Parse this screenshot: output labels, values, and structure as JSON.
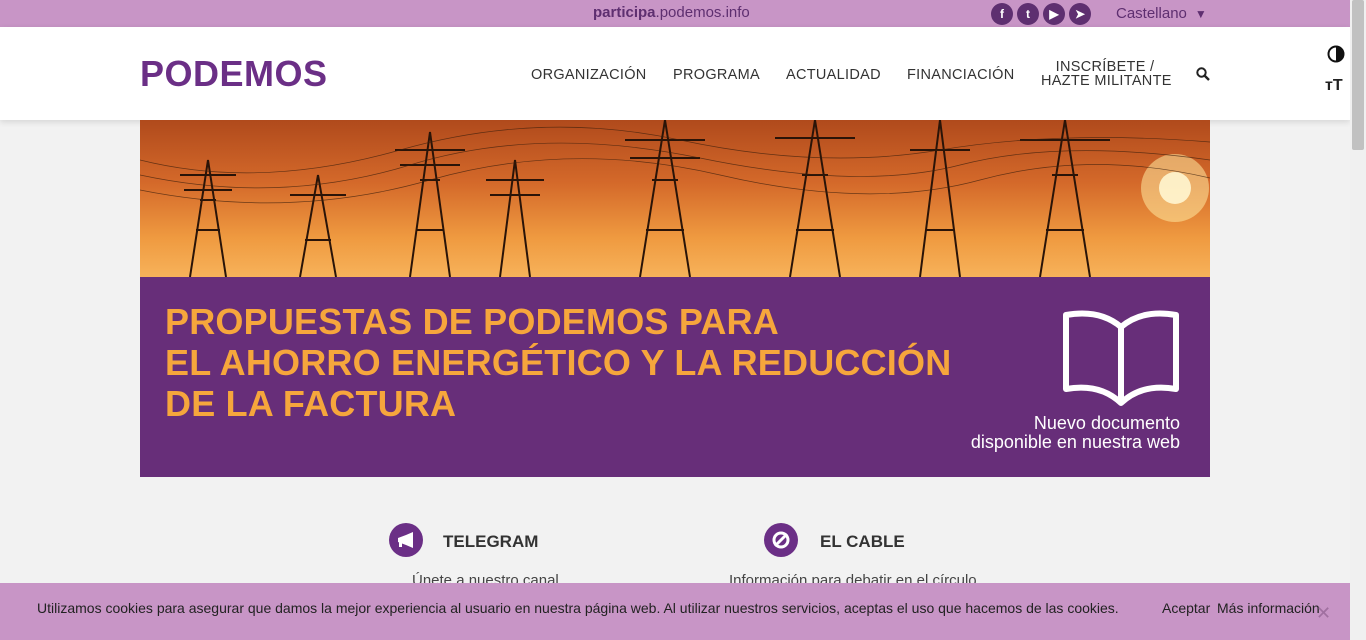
{
  "topbar": {
    "participa_bold": "participa",
    "participa_rest": ".podemos.info",
    "social": [
      {
        "name": "facebook-icon",
        "glyph": "f"
      },
      {
        "name": "twitter-icon",
        "glyph": "t"
      },
      {
        "name": "youtube-icon",
        "glyph": "▶"
      },
      {
        "name": "telegram-icon",
        "glyph": "➤"
      }
    ],
    "language": "Castellano"
  },
  "header": {
    "logo": "PODEMOS",
    "nav": [
      "ORGANIZACIÓN",
      "PROGRAMA",
      "ACTUALIDAD",
      "FINANCIACIÓN"
    ],
    "nav_cta_line1": "INSCRÍBETE /",
    "nav_cta_line2": "HAZTE MILITANTE"
  },
  "banner": {
    "headline_1": "PROPUESTAS DE PODEMOS PARA",
    "headline_2": "EL AHORRO ENERGÉTICO Y LA REDUCCIÓN",
    "headline_3": "DE LA FACTURA",
    "note_1": "Nuevo documento",
    "note_2": "disponible en nuestra web"
  },
  "cards": [
    {
      "title": "TELEGRAM",
      "desc": "Únete a nuestro canal",
      "icon": "megaphone-icon"
    },
    {
      "title": "EL CABLE",
      "desc": "Información para debatir en el círculo",
      "icon": "plug-icon"
    }
  ],
  "cookie": {
    "text": "Utilizamos cookies para asegurar que damos la mejor experiencia al usuario en nuestra página web. Al utilizar nuestros servicios, aceptas el uso que hacemos de las cookies.",
    "accept": "Aceptar",
    "more": "Más información",
    "close": "✕"
  },
  "colors": {
    "brand_purple": "#6b2f86",
    "topbar_pink": "#c895c6",
    "banner_orange": "#f6a63c"
  }
}
